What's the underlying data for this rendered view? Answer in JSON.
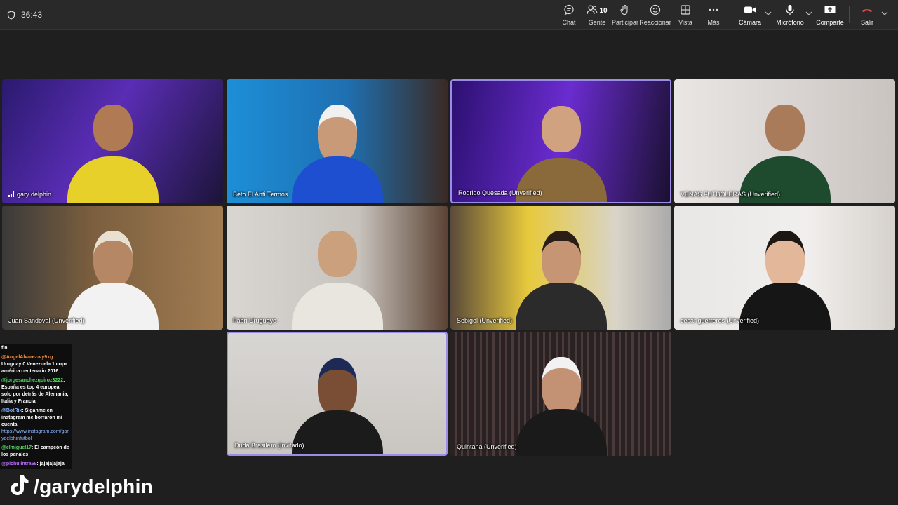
{
  "topbar": {
    "timer": "36:43",
    "people_count": "10",
    "buttons": {
      "chat": "Chat",
      "people": "Gente",
      "raise_hand": "Participar",
      "react": "Reaccionar",
      "view": "Vista",
      "more": "Más",
      "camera": "Cámara",
      "mic": "Micrófono",
      "share": "Comparte",
      "leave": "Salir"
    },
    "leave_color": "#e64a4a"
  },
  "participants": [
    {
      "name": "gary delphin",
      "speaking": true
    },
    {
      "name": "Beto El Anti Termos"
    },
    {
      "name": "Rodrigo Quesada (Unverified)",
      "active": true
    },
    {
      "name": "VENAS FUTBOLERAS (Unverified)"
    },
    {
      "name": "Juan Sandoval (Unverified)"
    },
    {
      "name": "Fabri Uruguayo"
    },
    {
      "name": "Sebigol (Unverified)"
    },
    {
      "name": "cesar guerreros (Unverified)"
    },
    {
      "name": "Duda Brasilero (Invitado)",
      "active": true
    },
    {
      "name": "Quintana (Unverified)"
    }
  ],
  "chat": [
    {
      "user": "",
      "text": "fin"
    },
    {
      "user": "@AngelAlvarez-vy9xg",
      "user_color": "#ff8a3d",
      "text": ": Uruguay 0 Venezuela 1 copa américa centenario 2016"
    },
    {
      "user": "@jorgesanchezquiroz3222",
      "user_color": "#4fdc5c",
      "text": ": España es top 4 europea, solo por detrás de Alemania, Italia y Francia"
    },
    {
      "user": "@BotRix",
      "user_color": "#7fb2ff",
      "text": ": Síganme en instagram me borraron mi cuenta",
      "link": "https://www.instagram.com/garydelphinfutbol"
    },
    {
      "user": "@elmiguel17",
      "user_color": "#4fdc5c",
      "text": ": El campeón de los penales"
    },
    {
      "user": "@pichulintra69",
      "user_color": "#b96bff",
      "text": ": jajajajajaja"
    }
  ],
  "watermark": "/garydelphin",
  "icons": {
    "shield": "shield-icon",
    "chat": "chat-bubble-icon",
    "people": "people-icon",
    "raise_hand": "hand-icon",
    "react": "smiley-icon",
    "view": "grid-view-icon",
    "more": "more-dots-icon",
    "camera": "video-camera-icon",
    "mic": "microphone-icon",
    "share": "share-screen-icon",
    "leave": "hang-up-icon",
    "tiktok": "tiktok-logo-icon"
  }
}
